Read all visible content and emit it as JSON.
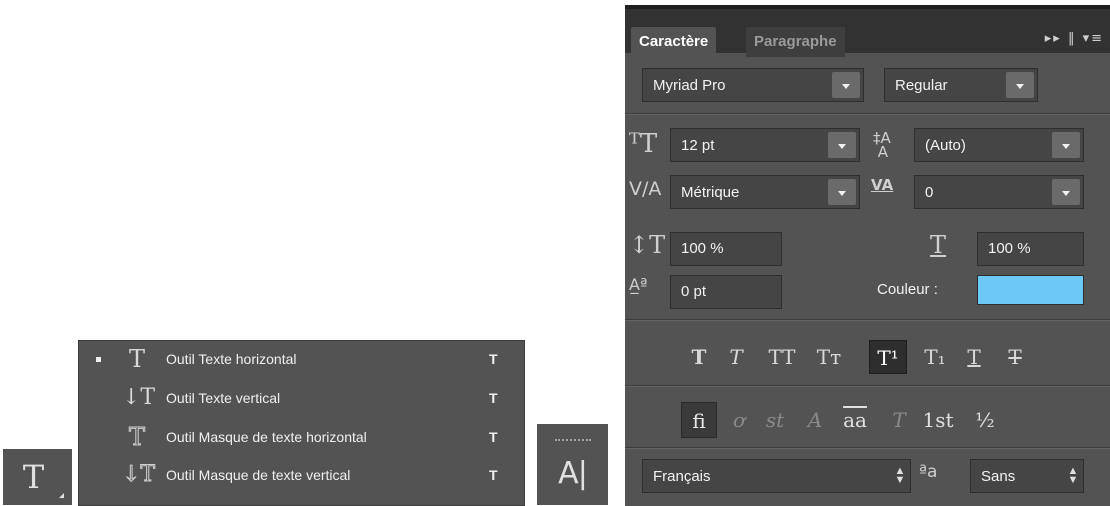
{
  "tool_button": {
    "glyph": "T"
  },
  "flyout": {
    "items": [
      {
        "label": "Outil Texte horizontal",
        "shortcut": "T",
        "icon": "T",
        "icon_name": "horizontal-type-icon",
        "selected": true
      },
      {
        "label": "Outil Texte vertical",
        "shortcut": "T",
        "icon": "↓T",
        "icon_name": "vertical-type-icon",
        "selected": false
      },
      {
        "label": "Outil Masque de texte horizontal",
        "shortcut": "T",
        "icon": "T",
        "icon_name": "horizontal-type-mask-icon",
        "selected": false
      },
      {
        "label": "Outil Masque de texte vertical",
        "shortcut": "T",
        "icon": "↓T",
        "icon_name": "vertical-type-mask-icon",
        "selected": false
      }
    ]
  },
  "text_tool_button": {
    "glyph": "A|"
  },
  "panel": {
    "tabs": {
      "character": "Caractère",
      "paragraph": "Paragraphe"
    },
    "menu_glyph": "▸▸ ‖ ▾≡",
    "font_family": "Myriad Pro",
    "font_style": "Regular",
    "font_size": "12 pt",
    "leading": "(Auto)",
    "kerning": "Métrique",
    "tracking": "0",
    "vertical_scale": "100 %",
    "horizontal_scale": "100 %",
    "baseline_shift": "0 pt",
    "color_label": "Couleur :",
    "color_value": "#6cc8f4",
    "style_buttons": [
      "T",
      "T",
      "TT",
      "Tт",
      "T¹",
      "T₁",
      "T",
      "T"
    ],
    "opentype_buttons": [
      "ﬁ",
      "ơ",
      "st",
      "A",
      "aa",
      "T",
      "1st",
      "½"
    ],
    "language": "Français",
    "aa_glyph": "ªa",
    "antialias": "Sans"
  }
}
